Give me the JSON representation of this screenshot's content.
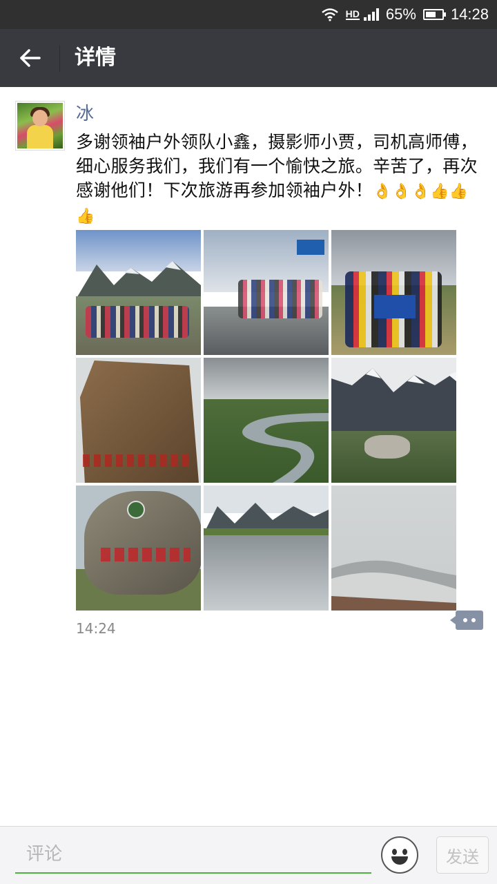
{
  "status_bar": {
    "battery_percent": "65%",
    "time": "14:28",
    "network_label": "HD"
  },
  "header": {
    "title": "详情"
  },
  "post": {
    "username": "冰",
    "text": "多谢领袖户外领队小鑫，摄影师小贾，司机高师傅，细心服务我们，我们有一个愉快之旅。辛苦了，再次感谢他们！下次旅游再参加领袖户外！",
    "emojis": [
      "👌",
      "👌",
      "👌",
      "👍",
      "👍",
      "👍"
    ],
    "time": "14:24",
    "photos": [
      {
        "name": "group-photo-mountain-lake"
      },
      {
        "name": "group-photo-road-sign"
      },
      {
        "name": "group-photo-banner"
      },
      {
        "name": "stone-tablet"
      },
      {
        "name": "river-valley"
      },
      {
        "name": "snow-mountains-lake"
      },
      {
        "name": "red-inscribed-rock"
      },
      {
        "name": "mountain-reflection"
      },
      {
        "name": "foggy-snow-slope"
      }
    ]
  },
  "bottom_bar": {
    "comment_placeholder": "评论",
    "send_label": "发送"
  },
  "colors": {
    "header_bg": "#393a3f",
    "username": "#576b95",
    "input_underline": "#4cb13f"
  }
}
